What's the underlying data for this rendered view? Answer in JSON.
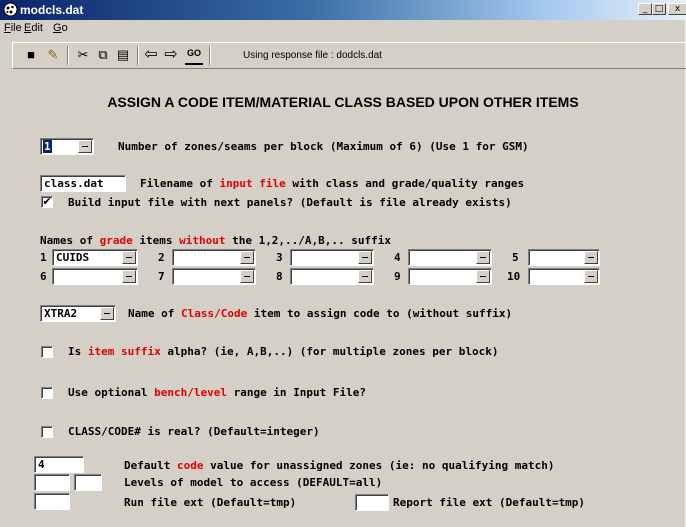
{
  "window": {
    "title": "modcls.dat",
    "min_glyph": "_",
    "max_glyph": "□",
    "close_glyph": "x"
  },
  "menu": [
    {
      "label": "File",
      "ul": "F",
      "rest": "ile"
    },
    {
      "label": "Edit",
      "ul": "E",
      "rest": "dit"
    },
    {
      "label": "Go",
      "ul": "G",
      "rest": "o"
    }
  ],
  "toolbar": {
    "response_text": "Using response file : dodcls.dat",
    "icons": [
      "save-icon",
      "open-icon",
      "cut-icon",
      "copy-icon",
      "paste-icon",
      "back-arrow-icon",
      "forward-arrow-icon",
      "go-icon"
    ],
    "glyphs": {
      "save": "■",
      "open": "✎",
      "cut": "✂",
      "copy": "⧉",
      "paste": "▤",
      "back": "⇦",
      "forward": "⇨",
      "go": "GO"
    }
  },
  "heading": "ASSIGN A CODE ITEM/MATERIAL CLASS BASED UPON OTHER ITEMS",
  "zones": {
    "value": "1",
    "label": "Number of zones/seams per block (Maximum of 6) (Use 1 for GSM)"
  },
  "input_file": {
    "value": "class.dat",
    "label_pre": "Filename of ",
    "label_red": "input file",
    "label_post": " with class and grade/quality ranges"
  },
  "build_input": {
    "checked": true,
    "label": "Build input file with next panels? (Default is file already exists)"
  },
  "grade_items": {
    "label_p1": "Names of ",
    "label_red1": "grade",
    "label_p2": " items ",
    "label_red2": "without",
    "label_p3": " the 1,2,../A,B,.. suffix",
    "items": [
      {
        "num": "1",
        "value": "CUIDS"
      },
      {
        "num": "2",
        "value": ""
      },
      {
        "num": "3",
        "value": ""
      },
      {
        "num": "4",
        "value": ""
      },
      {
        "num": "5",
        "value": ""
      },
      {
        "num": "6",
        "value": ""
      },
      {
        "num": "7",
        "value": ""
      },
      {
        "num": "8",
        "value": ""
      },
      {
        "num": "9",
        "value": ""
      },
      {
        "num": "10",
        "value": ""
      }
    ]
  },
  "class_item": {
    "value": "XTRA2",
    "label_pre": "Name of ",
    "label_red": "Class/Code",
    "label_post": " item to assign code to (without suffix)"
  },
  "suffix_alpha": {
    "checked": false,
    "label_pre": "Is ",
    "label_red": "item suffix",
    "label_post": " alpha? (ie, A,B,..) (for multiple zones per block)"
  },
  "bench_range": {
    "checked": false,
    "label_pre": "Use optional ",
    "label_red": "bench/level",
    "label_post": " range in Input File?"
  },
  "code_real": {
    "checked": false,
    "label": "CLASS/CODE# is real? (Default=integer)"
  },
  "default_code": {
    "value": "4",
    "label_pre": "Default ",
    "label_red": "code",
    "label_post": " value for unassigned zones (ie: no qualifying match)"
  },
  "levels": {
    "value_from": "",
    "value_to": "",
    "label": "Levels of model to access (DEFAULT=all)"
  },
  "run_ext": {
    "value": "",
    "label": "Run file ext (Default=tmp)"
  },
  "report_ext": {
    "value": "",
    "label": "Report file ext (Default=tmp)"
  },
  "check_glyph": "✔"
}
